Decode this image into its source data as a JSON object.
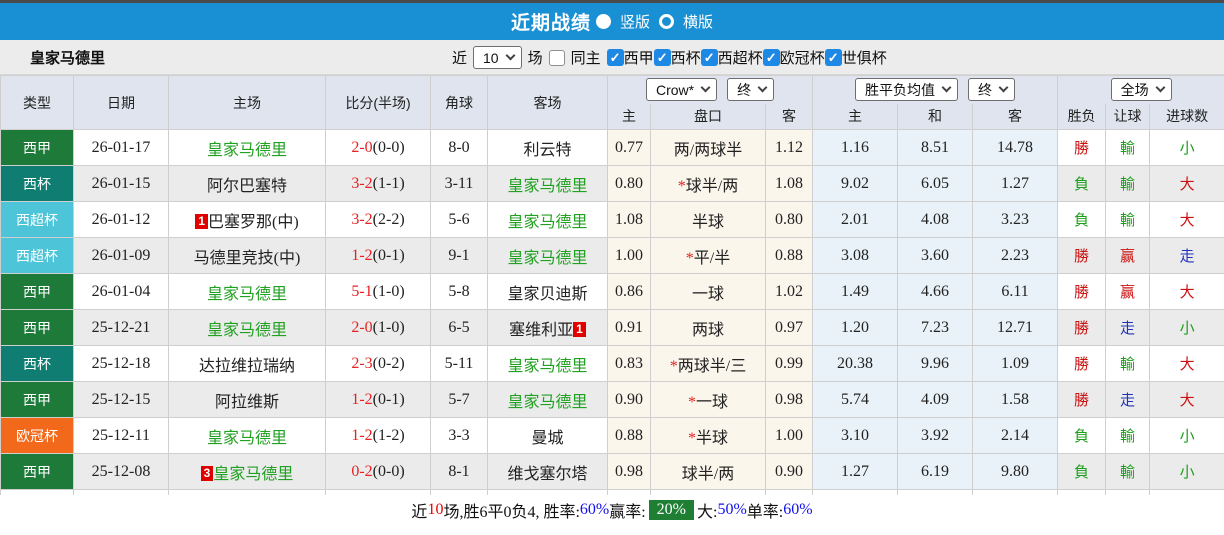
{
  "title_bar": {
    "title": "近期战绩",
    "radio_vertical": "竖版",
    "radio_horizontal": "横版"
  },
  "toolbar": {
    "team": "皇家马德里",
    "near_label": "近",
    "count_value": "10",
    "matches_label": "场",
    "same_home_label": "同主",
    "leagues": [
      "西甲",
      "西杯",
      "西超杯",
      "欧冠杯",
      "世俱杯"
    ]
  },
  "colors": {
    "accent_blue": "#1890d3",
    "checkbox_blue": "#1e88e5",
    "type": {
      "西甲": "#1e7a38",
      "西杯": "#0f7d72",
      "西超杯": "#4ec4d8",
      "欧冠杯": "#f2691c"
    },
    "team_green": "#21a121",
    "score_red": "#e62222",
    "win_red": "#cc1111",
    "lose_green": "#1ca01c",
    "draw_blue": "#2233bb",
    "footer_badge_green": "#1e7e34",
    "footer_blue": "#1111ee"
  },
  "table": {
    "headers": {
      "type": "类型",
      "date": "日期",
      "home": "主场",
      "score": "比分(半场)",
      "corner": "角球",
      "away": "客场",
      "h": "主",
      "line": "盘口",
      "a": "客",
      "m_h": "主",
      "m_d": "和",
      "m_a": "客",
      "res_wdl": "胜负",
      "res_handicap": "让球",
      "res_goals": "进球数"
    },
    "selects": {
      "crow": "Crow*",
      "crow_end": "终",
      "wdl": "胜平负均值",
      "wdl_end": "终",
      "full": "全场"
    },
    "rows": [
      {
        "type": "西甲",
        "date": "26-01-17",
        "home": {
          "name": "皇家马德里",
          "green": true
        },
        "score": "2-0",
        "half": "(0-0)",
        "corner": "8-0",
        "away": {
          "name": "利云特"
        },
        "crow": {
          "home": "0.77",
          "star": false,
          "line": "两/两球半",
          "away": "1.12"
        },
        "mean": {
          "home": "1.16",
          "draw": "8.51",
          "away": "14.78"
        },
        "res": [
          {
            "t": "勝",
            "c": "red"
          },
          {
            "t": "輸",
            "c": "green"
          },
          {
            "t": "小",
            "c": "green"
          }
        ]
      },
      {
        "type": "西杯",
        "date": "26-01-15",
        "home": {
          "name": "阿尔巴塞特"
        },
        "score": "3-2",
        "half": "(1-1)",
        "corner": "3-11",
        "away": {
          "name": "皇家马德里",
          "green": true
        },
        "crow": {
          "home": "0.80",
          "star": true,
          "line": "球半/两",
          "away": "1.08"
        },
        "mean": {
          "home": "9.02",
          "draw": "6.05",
          "away": "1.27"
        },
        "res": [
          {
            "t": "負",
            "c": "green"
          },
          {
            "t": "輸",
            "c": "green"
          },
          {
            "t": "大",
            "c": "red"
          }
        ]
      },
      {
        "type": "西超杯",
        "date": "26-01-12",
        "home": {
          "name": "巴塞罗那(中)",
          "badge": "1",
          "badge_pos": "before"
        },
        "score": "3-2",
        "half": "(2-2)",
        "corner": "5-6",
        "away": {
          "name": "皇家马德里",
          "green": true
        },
        "crow": {
          "home": "1.08",
          "star": false,
          "line": "半球",
          "away": "0.80"
        },
        "mean": {
          "home": "2.01",
          "draw": "4.08",
          "away": "3.23"
        },
        "res": [
          {
            "t": "負",
            "c": "green"
          },
          {
            "t": "輸",
            "c": "green"
          },
          {
            "t": "大",
            "c": "red"
          }
        ]
      },
      {
        "type": "西超杯",
        "date": "26-01-09",
        "home": {
          "name": "马德里竞技(中)"
        },
        "score": "1-2",
        "half": "(0-1)",
        "corner": "9-1",
        "away": {
          "name": "皇家马德里",
          "green": true
        },
        "crow": {
          "home": "1.00",
          "star": true,
          "line": "平/半",
          "away": "0.88"
        },
        "mean": {
          "home": "3.08",
          "draw": "3.60",
          "away": "2.23"
        },
        "res": [
          {
            "t": "勝",
            "c": "red"
          },
          {
            "t": "赢",
            "c": "red"
          },
          {
            "t": "走",
            "c": "blue"
          }
        ]
      },
      {
        "type": "西甲",
        "date": "26-01-04",
        "home": {
          "name": "皇家马德里",
          "green": true
        },
        "score": "5-1",
        "half": "(1-0)",
        "corner": "5-8",
        "away": {
          "name": "皇家贝迪斯"
        },
        "crow": {
          "home": "0.86",
          "star": false,
          "line": "一球",
          "away": "1.02"
        },
        "mean": {
          "home": "1.49",
          "draw": "4.66",
          "away": "6.11"
        },
        "res": [
          {
            "t": "勝",
            "c": "red"
          },
          {
            "t": "赢",
            "c": "red"
          },
          {
            "t": "大",
            "c": "red"
          }
        ]
      },
      {
        "type": "西甲",
        "date": "25-12-21",
        "home": {
          "name": "皇家马德里",
          "green": true
        },
        "score": "2-0",
        "half": "(1-0)",
        "corner": "6-5",
        "away": {
          "name": "塞维利亚",
          "badge": "1",
          "badge_pos": "after"
        },
        "crow": {
          "home": "0.91",
          "star": false,
          "line": "两球",
          "away": "0.97"
        },
        "mean": {
          "home": "1.20",
          "draw": "7.23",
          "away": "12.71"
        },
        "res": [
          {
            "t": "勝",
            "c": "red"
          },
          {
            "t": "走",
            "c": "blue"
          },
          {
            "t": "小",
            "c": "green"
          }
        ]
      },
      {
        "type": "西杯",
        "date": "25-12-18",
        "home": {
          "name": "达拉维拉瑞纳"
        },
        "score": "2-3",
        "half": "(0-2)",
        "corner": "5-11",
        "away": {
          "name": "皇家马德里",
          "green": true
        },
        "crow": {
          "home": "0.83",
          "star": true,
          "line": "两球半/三",
          "away": "0.99"
        },
        "mean": {
          "home": "20.38",
          "draw": "9.96",
          "away": "1.09"
        },
        "res": [
          {
            "t": "勝",
            "c": "red"
          },
          {
            "t": "輸",
            "c": "green"
          },
          {
            "t": "大",
            "c": "red"
          }
        ]
      },
      {
        "type": "西甲",
        "date": "25-12-15",
        "home": {
          "name": "阿拉维斯"
        },
        "score": "1-2",
        "half": "(0-1)",
        "corner": "5-7",
        "away": {
          "name": "皇家马德里",
          "green": true
        },
        "crow": {
          "home": "0.90",
          "star": true,
          "line": "一球",
          "away": "0.98"
        },
        "mean": {
          "home": "5.74",
          "draw": "4.09",
          "away": "1.58"
        },
        "res": [
          {
            "t": "勝",
            "c": "red"
          },
          {
            "t": "走",
            "c": "blue"
          },
          {
            "t": "大",
            "c": "red"
          }
        ]
      },
      {
        "type": "欧冠杯",
        "date": "25-12-11",
        "home": {
          "name": "皇家马德里",
          "green": true
        },
        "score": "1-2",
        "half": "(1-2)",
        "corner": "3-3",
        "away": {
          "name": "曼城"
        },
        "crow": {
          "home": "0.88",
          "star": true,
          "line": "半球",
          "away": "1.00"
        },
        "mean": {
          "home": "3.10",
          "draw": "3.92",
          "away": "2.14"
        },
        "res": [
          {
            "t": "負",
            "c": "green"
          },
          {
            "t": "輸",
            "c": "green"
          },
          {
            "t": "小",
            "c": "green"
          }
        ]
      },
      {
        "type": "西甲",
        "date": "25-12-08",
        "home": {
          "name": "皇家马德里",
          "green": true,
          "badge": "3",
          "badge_pos": "before"
        },
        "score": "0-2",
        "half": "(0-0)",
        "corner": "8-1",
        "away": {
          "name": "维戈塞尔塔"
        },
        "crow": {
          "home": "0.98",
          "star": false,
          "line": "球半/两",
          "away": "0.90"
        },
        "mean": {
          "home": "1.27",
          "draw": "6.19",
          "away": "9.80"
        },
        "res": [
          {
            "t": "負",
            "c": "green"
          },
          {
            "t": "輸",
            "c": "green"
          },
          {
            "t": "小",
            "c": "green"
          }
        ]
      }
    ]
  },
  "footer": {
    "segments": [
      {
        "t": "近",
        "c": "plain"
      },
      {
        "t": "10",
        "c": "red"
      },
      {
        "t": "场,胜6平0负4, 胜率:",
        "c": "plain"
      },
      {
        "t": "60%",
        "c": "blue"
      },
      {
        "t": " 赢率:",
        "c": "plain"
      },
      {
        "t": "20%",
        "c": "badge"
      },
      {
        "t": " 大:",
        "c": "plain"
      },
      {
        "t": "50%",
        "c": "blue"
      },
      {
        "t": " 单率:",
        "c": "plain"
      },
      {
        "t": "60%",
        "c": "blue"
      }
    ]
  }
}
